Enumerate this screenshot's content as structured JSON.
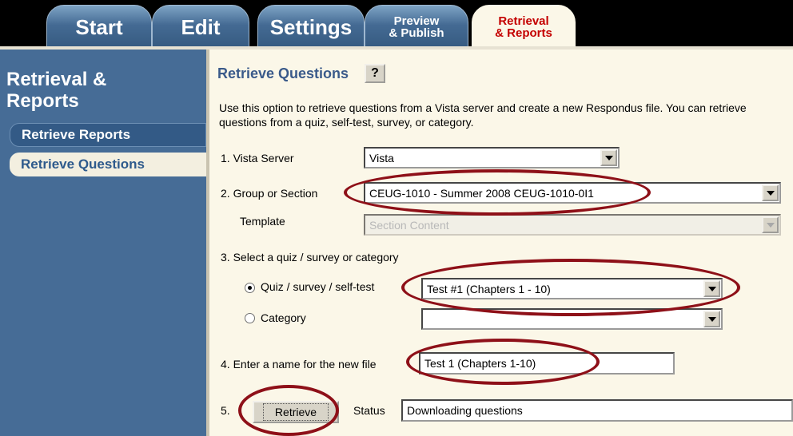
{
  "tabs": [
    {
      "label": "Start"
    },
    {
      "label": "Edit"
    },
    {
      "label": "Settings"
    },
    {
      "label_line1": "Preview",
      "label_line2": "& Publish"
    },
    {
      "label_line1": "Retrieval",
      "label_line2": "& Reports"
    }
  ],
  "sidebar": {
    "title_line1": "Retrieval &",
    "title_line2": "Reports",
    "items": [
      {
        "label": "Retrieve Reports"
      },
      {
        "label": "Retrieve Questions"
      }
    ]
  },
  "main": {
    "heading": "Retrieve Questions",
    "help_label": "?",
    "description": "Use this option to retrieve questions from a Vista server and create a new Respondus file.  You can retrieve questions from a quiz, self-test, survey, or category.",
    "vista_server": {
      "label": "1.  Vista Server",
      "value": "Vista"
    },
    "group_section": {
      "label": "2.  Group or Section",
      "value": "CEUG-1010 - Summer 2008 CEUG-1010-0I1"
    },
    "template": {
      "label": "Template",
      "value": "Section Content"
    },
    "step3_label": "3.  Select a quiz / survey or category",
    "quiz_option": {
      "label": "Quiz / survey / self-test",
      "value": "Test #1 (Chapters 1 - 10)"
    },
    "category_option": {
      "label": "Category",
      "value": ""
    },
    "new_file": {
      "label": "4.  Enter a name for the new file",
      "value": "Test 1 (Chapters 1-10)"
    },
    "step5_label": "5.",
    "retrieve_label": "Retrieve",
    "status_label": "Status",
    "status_value": "Downloading questions"
  },
  "colors": {
    "tab_blue": "#446a93",
    "sidebar": "#466c96",
    "panel": "#fbf7e8",
    "highlight_ellipse": "#8e1018",
    "active_tab_text": "#c00000"
  },
  "icons": [
    "help-question-icon",
    "dropdown-arrow-icon",
    "radio-selected-icon",
    "radio-unselected-icon"
  ]
}
